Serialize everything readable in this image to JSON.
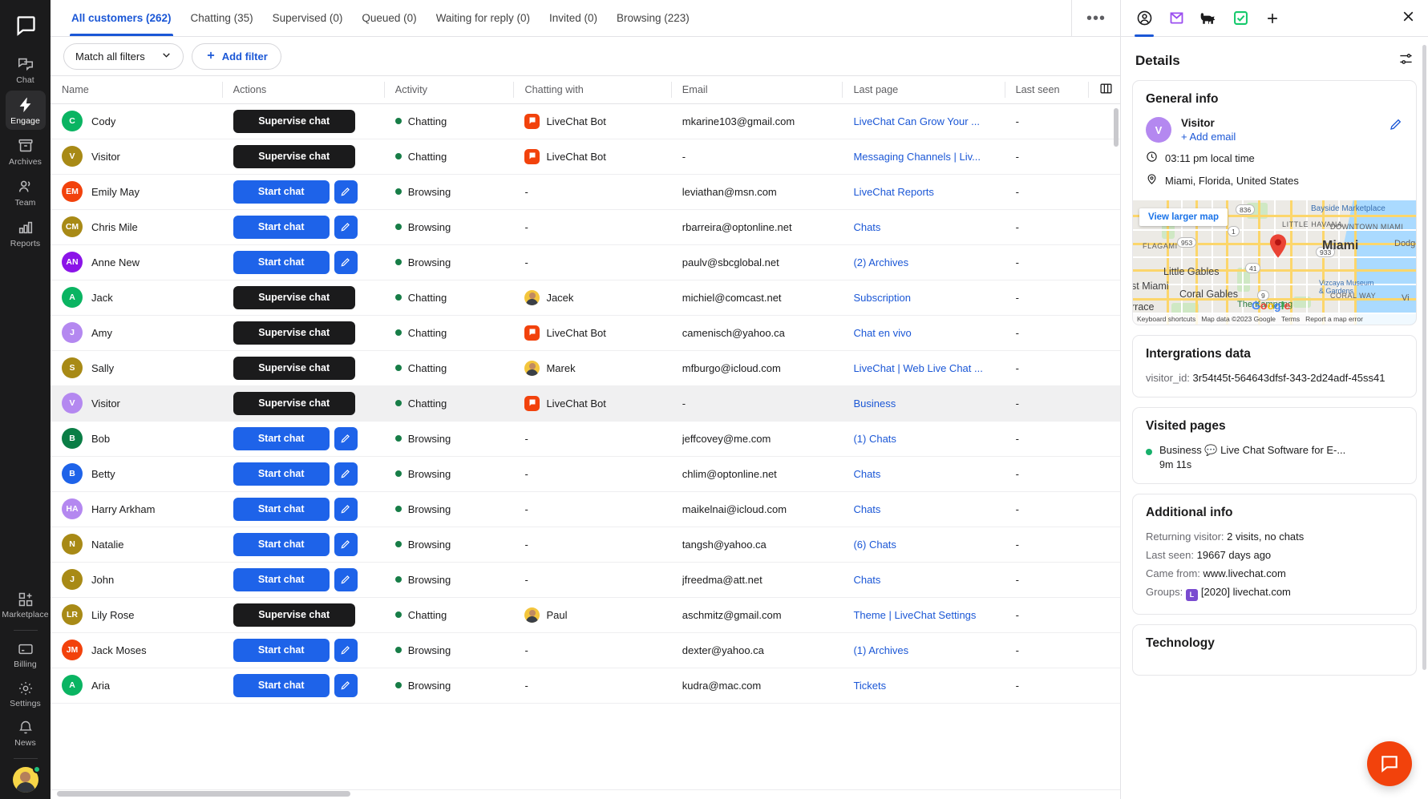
{
  "left_nav": {
    "logo": "livechat-logo",
    "items": [
      {
        "label": "Chat",
        "icon": "chat-icon",
        "active": false
      },
      {
        "label": "Engage",
        "icon": "lightning-icon",
        "active": true
      },
      {
        "label": "Archives",
        "icon": "archive-icon",
        "active": false
      },
      {
        "label": "Team",
        "icon": "team-icon",
        "active": false
      },
      {
        "label": "Reports",
        "icon": "reports-bar-icon",
        "active": false
      }
    ],
    "bottom_items": [
      {
        "label": "Marketplace",
        "icon": "marketplace-grid-plus-icon"
      },
      {
        "label": "Billing",
        "icon": "credit-card-icon"
      },
      {
        "label": "Settings",
        "icon": "gear-icon"
      },
      {
        "label": "News",
        "icon": "bell-icon"
      }
    ],
    "avatar": "user-avatar"
  },
  "tabs": [
    {
      "label": "All customers (262)",
      "active": true
    },
    {
      "label": "Chatting (35)",
      "active": false
    },
    {
      "label": "Supervised (0)",
      "active": false
    },
    {
      "label": "Queued (0)",
      "active": false
    },
    {
      "label": "Waiting for reply (0)",
      "active": false
    },
    {
      "label": "Invited (0)",
      "active": false
    },
    {
      "label": "Browsing (223)",
      "active": false
    }
  ],
  "toolbar": {
    "more_options": "•••",
    "match_filters_label": "Match all filters",
    "add_filter_label": "Add filter",
    "add_filter_plus": "+"
  },
  "table": {
    "columns": [
      "Name",
      "Actions",
      "Activity",
      "Chatting with",
      "Email",
      "Last page",
      "Last seen"
    ],
    "columns_icon": "columns-settings-icon",
    "rows": [
      {
        "initials": "C",
        "avatar_color": "#0ab462",
        "name": "Cody",
        "action": "Supervise chat",
        "action_type": "supervise",
        "activity": "Chatting",
        "chatting_with": "LiveChat Bot",
        "chatting_with_type": "bot",
        "email": "mkarine103@gmail.com",
        "last_page": "LiveChat Can Grow Your ...",
        "last_seen": "-",
        "selected": false
      },
      {
        "initials": "V",
        "avatar_color": "#a88a16",
        "name": "Visitor",
        "action": "Supervise chat",
        "action_type": "supervise",
        "activity": "Chatting",
        "chatting_with": "LiveChat Bot",
        "chatting_with_type": "bot",
        "email": "-",
        "last_page": "Messaging Channels | Liv...",
        "last_seen": "-",
        "selected": false
      },
      {
        "initials": "EM",
        "avatar_color": "#f2420c",
        "name": "Emily May",
        "action": "Start chat",
        "action_type": "start",
        "activity": "Browsing",
        "chatting_with": "-",
        "chatting_with_type": "none",
        "email": "leviathan@msn.com",
        "last_page": "LiveChat Reports",
        "last_seen": "-",
        "selected": false
      },
      {
        "initials": "CM",
        "avatar_color": "#a88a16",
        "name": "Chris Mile",
        "action": "Start chat",
        "action_type": "start",
        "activity": "Browsing",
        "chatting_with": "-",
        "chatting_with_type": "none",
        "email": "rbarreira@optonline.net",
        "last_page": "Chats",
        "last_seen": "-",
        "selected": false
      },
      {
        "initials": "AN",
        "avatar_color": "#8b14e8",
        "name": "Anne New",
        "action": "Start chat",
        "action_type": "start",
        "activity": "Browsing",
        "chatting_with": "-",
        "chatting_with_type": "none",
        "email": "paulv@sbcglobal.net",
        "last_page": "(2) Archives",
        "last_seen": "-",
        "selected": false
      },
      {
        "initials": "A",
        "avatar_color": "#0ab462",
        "name": "Jack",
        "action": "Supervise chat",
        "action_type": "supervise",
        "activity": "Chatting",
        "chatting_with": "Jacek",
        "chatting_with_type": "agent",
        "email": "michiel@comcast.net",
        "last_page": "Subscription",
        "last_seen": "-",
        "selected": false
      },
      {
        "initials": "J",
        "avatar_color": "#b488f0",
        "name": "Amy",
        "action": "Supervise chat",
        "action_type": "supervise",
        "activity": "Chatting",
        "chatting_with": "LiveChat Bot",
        "chatting_with_type": "bot",
        "email": "camenisch@yahoo.ca",
        "last_page": "Chat en vivo",
        "last_seen": "-",
        "selected": false
      },
      {
        "initials": "S",
        "avatar_color": "#a88a16",
        "name": "Sally",
        "action": "Supervise chat",
        "action_type": "supervise",
        "activity": "Chatting",
        "chatting_with": "Marek",
        "chatting_with_type": "agent",
        "email": "mfburgo@icloud.com",
        "last_page": "LiveChat | Web Live Chat ...",
        "last_seen": "-",
        "selected": false
      },
      {
        "initials": "V",
        "avatar_color": "#b488f0",
        "name": "Visitor",
        "action": "Supervise chat",
        "action_type": "supervise",
        "activity": "Chatting",
        "chatting_with": "LiveChat Bot",
        "chatting_with_type": "bot",
        "email": "-",
        "last_page": "Business",
        "last_seen": "-",
        "selected": true
      },
      {
        "initials": "B",
        "avatar_color": "#0a7d45",
        "name": "Bob",
        "action": "Start chat",
        "action_type": "start",
        "activity": "Browsing",
        "chatting_with": "-",
        "chatting_with_type": "none",
        "email": "jeffcovey@me.com",
        "last_page": "(1) Chats",
        "last_seen": "-",
        "selected": false
      },
      {
        "initials": "B",
        "avatar_color": "#1e63e9",
        "name": "Betty",
        "action": "Start chat",
        "action_type": "start",
        "activity": "Browsing",
        "chatting_with": "-",
        "chatting_with_type": "none",
        "email": "chlim@optonline.net",
        "last_page": "Chats",
        "last_seen": "-",
        "selected": false
      },
      {
        "initials": "HA",
        "avatar_color": "#b488f0",
        "name": "Harry Arkham",
        "action": "Start chat",
        "action_type": "start",
        "activity": "Browsing",
        "chatting_with": "-",
        "chatting_with_type": "none",
        "email": "maikelnai@icloud.com",
        "last_page": "Chats",
        "last_seen": "-",
        "selected": false
      },
      {
        "initials": "N",
        "avatar_color": "#a88a16",
        "name": "Natalie",
        "action": "Start chat",
        "action_type": "start",
        "activity": "Browsing",
        "chatting_with": "-",
        "chatting_with_type": "none",
        "email": "tangsh@yahoo.ca",
        "last_page": "(6) Chats",
        "last_seen": "-",
        "selected": false
      },
      {
        "initials": "J",
        "avatar_color": "#a88a16",
        "name": "John",
        "action": "Start chat",
        "action_type": "start",
        "activity": "Browsing",
        "chatting_with": "-",
        "chatting_with_type": "none",
        "email": "jfreedma@att.net",
        "last_page": "Chats",
        "last_seen": "-",
        "selected": false
      },
      {
        "initials": "LR",
        "avatar_color": "#a88a16",
        "name": "Lily Rose",
        "action": "Supervise chat",
        "action_type": "supervise",
        "activity": "Chatting",
        "chatting_with": "Paul",
        "chatting_with_type": "agent",
        "email": "aschmitz@gmail.com",
        "last_page": "Theme | LiveChat Settings",
        "last_seen": "-",
        "selected": false
      },
      {
        "initials": "JM",
        "avatar_color": "#f2420c",
        "name": "Jack Moses",
        "action": "Start chat",
        "action_type": "start",
        "activity": "Browsing",
        "chatting_with": "-",
        "chatting_with_type": "none",
        "email": "dexter@yahoo.ca",
        "last_page": "(1) Archives",
        "last_seen": "-",
        "selected": false
      },
      {
        "initials": "A",
        "avatar_color": "#0ab462",
        "name": "Aria",
        "action": "Start chat",
        "action_type": "start",
        "activity": "Browsing",
        "chatting_with": "-",
        "chatting_with_type": "none",
        "email": "kudra@mac.com",
        "last_page": "Tickets",
        "last_seen": "-",
        "selected": false
      }
    ]
  },
  "details": {
    "panel_tabs": [
      {
        "icon": "user-circle-icon",
        "active": true
      },
      {
        "icon": "mail-open-icon",
        "active": false
      },
      {
        "icon": "dog-icon",
        "active": false
      },
      {
        "icon": "check-square-icon",
        "active": false
      },
      {
        "icon": "plus-icon",
        "active": false
      }
    ],
    "close_icon": "close-icon",
    "title": "Details",
    "settings_icon": "sliders-icon",
    "general_info": {
      "heading": "General info",
      "avatar_initial": "V",
      "visitor_name": "Visitor",
      "add_email_label": "+ Add email",
      "edit_icon": "pencil-icon",
      "local_time": "03:11 pm local time",
      "location": "Miami, Florida, United States",
      "clock_icon": "clock-icon",
      "location_icon": "location-pin-icon"
    },
    "map": {
      "view_larger_label": "View larger map",
      "labels": [
        "LITTLE HAVANA",
        "FLAGAMI",
        "Little Gables",
        "st Miami",
        "Coral Gables",
        "Bayside Marketplace",
        "DOWNTOWN MIAMI",
        "Miami",
        "Vizcaya Museum & Gardens",
        "The Kampong",
        "rrace",
        "CORAL WAY",
        "Dodge",
        "Vi"
      ],
      "shields": [
        "836",
        "953",
        "41",
        "9",
        "933",
        "1"
      ],
      "attribution": [
        "Keyboard shortcuts",
        "Map data ©2023 Google",
        "Terms",
        "Report a map error"
      ],
      "logo_letters": [
        "G",
        "o",
        "o",
        "g",
        "l",
        "e"
      ],
      "pin_icon": "map-pin-icon"
    },
    "integrations": {
      "heading": "Intergrations data",
      "key": "visitor_id:",
      "value": "3r54t45t-564643dfsf-343-2d24adf-45ss41"
    },
    "visited_pages": {
      "heading": "Visited pages",
      "items": [
        {
          "title": "Business 💬 Live Chat Software for E-...",
          "duration": "9m 11s"
        }
      ]
    },
    "additional_info": {
      "heading": "Additional info",
      "rows": [
        {
          "key": "Returning visitor:",
          "value": "2 visits, no chats"
        },
        {
          "key": "Last seen:",
          "value": "19667 days ago"
        },
        {
          "key": "Came from:",
          "value": "www.livechat.com"
        },
        {
          "key": "Groups:",
          "value": "[2020] livechat.com",
          "badge": "L"
        }
      ]
    },
    "technology": {
      "heading": "Technology"
    },
    "fab_icon": "chat-bubble-icon"
  }
}
